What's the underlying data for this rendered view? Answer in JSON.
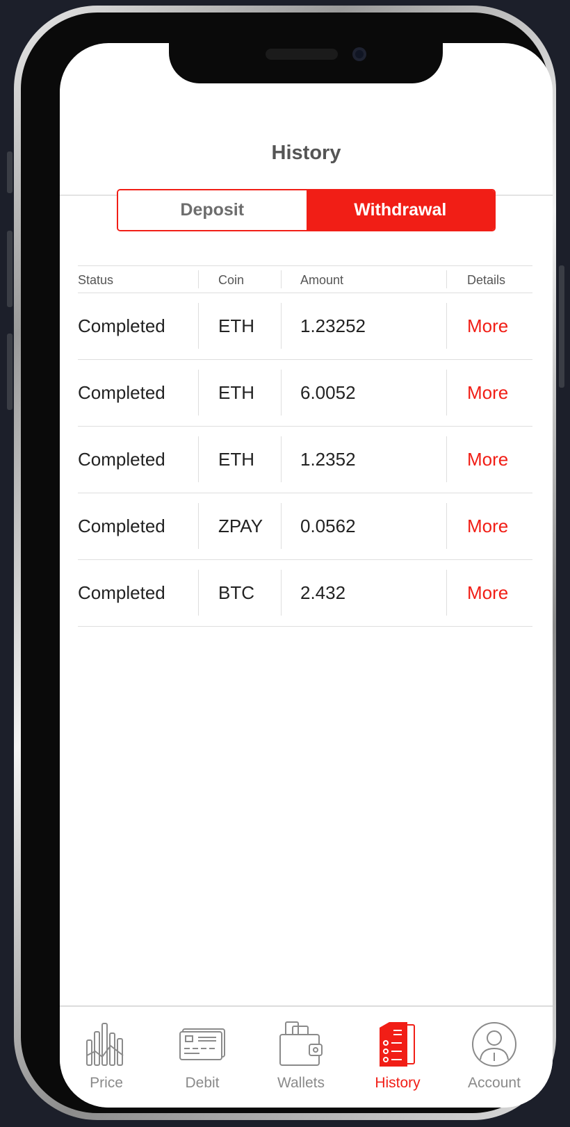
{
  "header": {
    "title": "History"
  },
  "segmented": {
    "deposit_label": "Deposit",
    "withdrawal_label": "Withdrawal",
    "selected": "Withdrawal"
  },
  "table": {
    "columns": [
      "Status",
      "Coin",
      "Amount",
      "Details"
    ],
    "rows": [
      {
        "status": "Completed",
        "coin": "ETH",
        "amount": "1.23252",
        "details": "More"
      },
      {
        "status": "Completed",
        "coin": "ETH",
        "amount": "6.0052",
        "details": "More"
      },
      {
        "status": "Completed",
        "coin": "ETH",
        "amount": "1.2352",
        "details": "More"
      },
      {
        "status": "Completed",
        "coin": "ZPAY",
        "amount": "0.0562",
        "details": "More"
      },
      {
        "status": "Completed",
        "coin": "BTC",
        "amount": "2.432",
        "details": "More"
      }
    ]
  },
  "tabbar": {
    "items": [
      {
        "label": "Price",
        "icon": "price-chart-icon"
      },
      {
        "label": "Debit",
        "icon": "debit-card-icon"
      },
      {
        "label": "Wallets",
        "icon": "wallet-icon"
      },
      {
        "label": "History",
        "icon": "history-list-icon"
      },
      {
        "label": "Account",
        "icon": "account-user-icon"
      }
    ],
    "active": "History"
  },
  "colors": {
    "accent": "#f11e16",
    "text": "#222222",
    "muted": "#8a8a8a",
    "divider": "#dedede"
  }
}
